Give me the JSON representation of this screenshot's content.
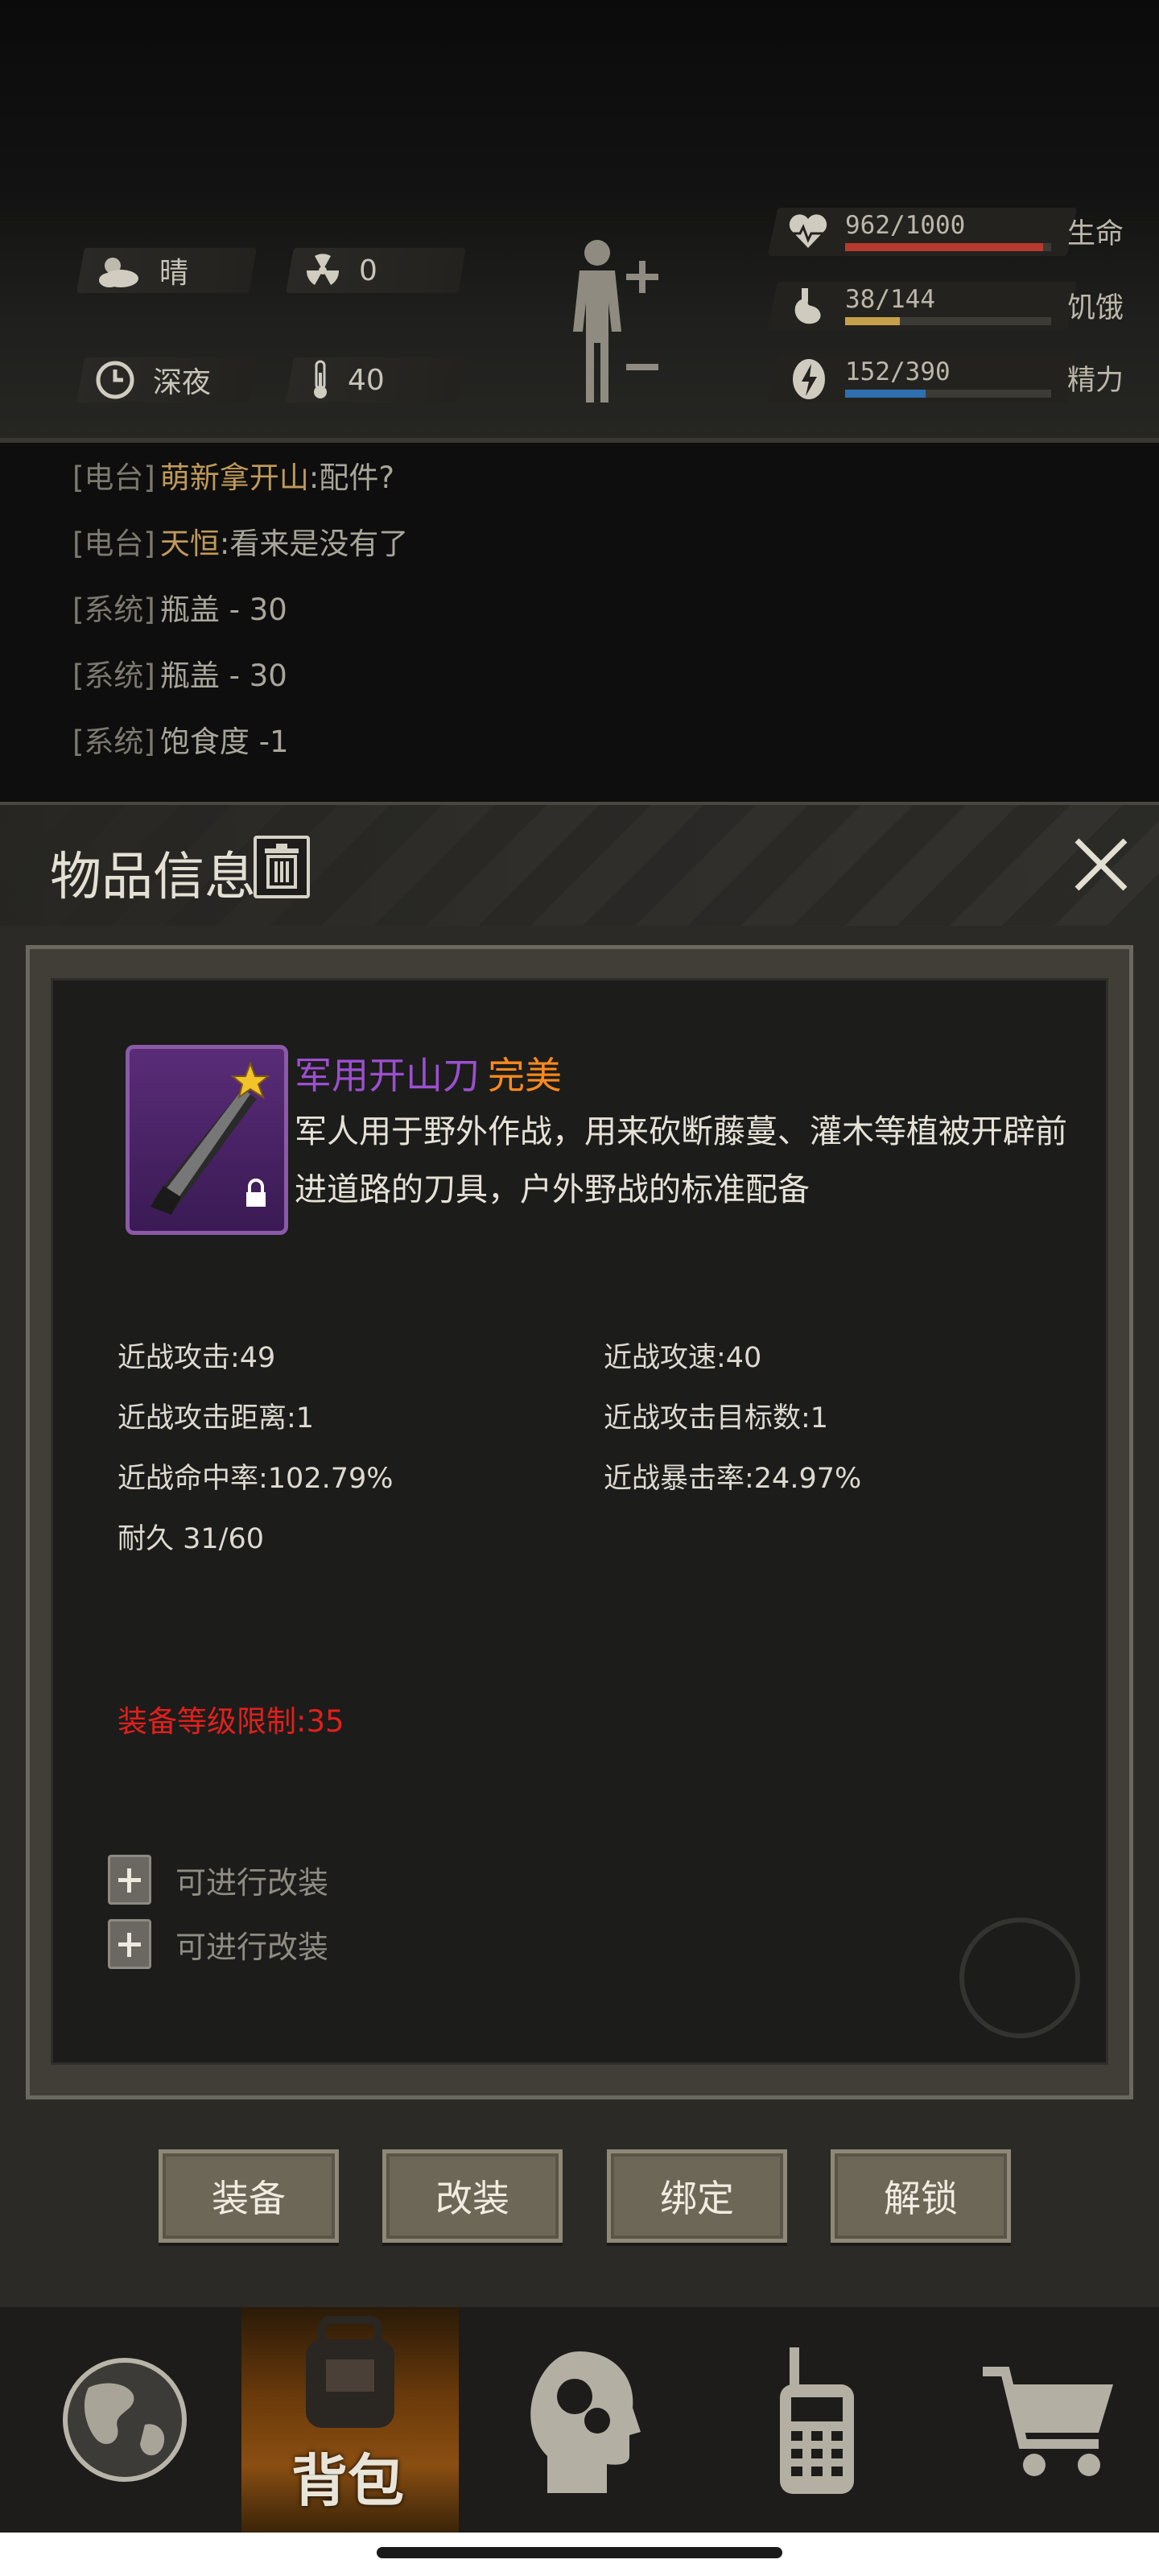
{
  "status": {
    "weather": {
      "icon": "cloud-sun-icon",
      "label": "晴"
    },
    "radiation": {
      "icon": "radiation-icon",
      "value": "0"
    },
    "time": {
      "icon": "clock-icon",
      "label": "深夜"
    },
    "temperature": {
      "icon": "thermometer-icon",
      "value": "40"
    },
    "stats": [
      {
        "icon": "heart-icon",
        "value": "962/1000",
        "label": "生命",
        "fill": 0.962,
        "color": "#b8392e"
      },
      {
        "icon": "stomach-icon",
        "value": "38/144",
        "label": "饥饿",
        "fill": 0.264,
        "color": "#c7a14a"
      },
      {
        "icon": "energy-icon",
        "value": "152/390",
        "label": "精力",
        "fill": 0.39,
        "color": "#2f6fb0"
      }
    ]
  },
  "log": [
    {
      "tag": "[电台]",
      "name": "萌新拿开山",
      "msg": ":配件?"
    },
    {
      "tag": "[电台]",
      "name": "天恒",
      "msg": ":看来是没有了"
    },
    {
      "tag": "[系统]",
      "name": "",
      "msg": "瓶盖 - 30"
    },
    {
      "tag": "[系统]",
      "name": "",
      "msg": "瓶盖 - 30"
    },
    {
      "tag": "[系统]",
      "name": "",
      "msg": "饱食度 -1"
    }
  ],
  "modal": {
    "title": "物品信息",
    "item": {
      "name": "军用开山刀",
      "quality": "完美",
      "description": "军人用于野外作战，用来砍断藤蔓、灌木等植被开辟前进道路的刀具，户外野战的标准配备"
    },
    "stats": [
      "近战攻击:49",
      "近战攻速:40",
      "近战攻击距离:1",
      "近战攻击目标数:1",
      "近战命中率:102.79%",
      "近战暴击率:24.97%",
      "耐久 31/60"
    ],
    "level_limit": "装备等级限制:35",
    "mods": [
      "可进行改装",
      "可进行改装"
    ],
    "buttons": [
      "装备",
      "改装",
      "绑定",
      "解锁"
    ]
  },
  "nav": {
    "items": [
      "globe-icon",
      "backpack-icon",
      "brain-icon",
      "radio-icon",
      "cart-icon"
    ],
    "active_label": "背包"
  }
}
